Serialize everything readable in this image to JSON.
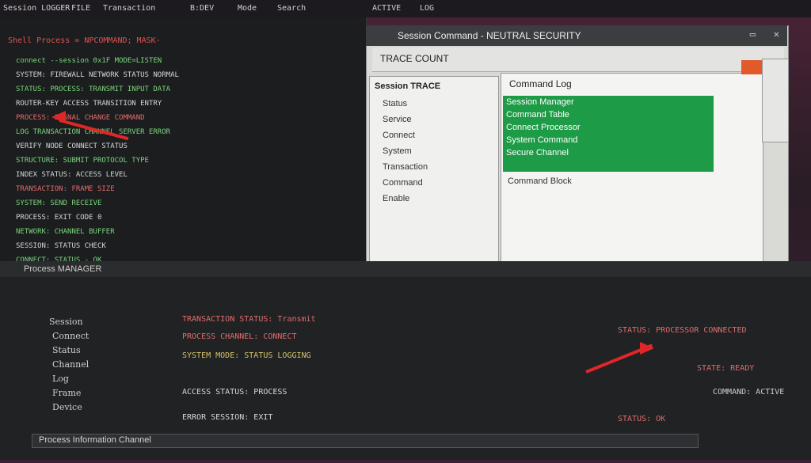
{
  "topbar": {
    "items": [
      "Session LOGGER",
      "FILE",
      "Transaction",
      "B:DEV",
      "Mode",
      "Search",
      "ACTIVE",
      "LOG"
    ]
  },
  "terminal": {
    "title": "Shell Process = NPCOMMAND; MASK-",
    "lines": [
      "  connect --session 0x1F  MODE=LISTEN",
      "  SYSTEM: FIREWALL NETWORK STATUS NORMAL",
      "  STATUS: PROCESS: TRANSMIT INPUT DATA",
      "  ROUTER-KEY ACCESS TRANSITION ENTRY",
      "  PROCESS: SIGNAL CHANGE COMMAND",
      "  LOG TRANSACTION CHANNEL SERVER ERROR",
      "  VERIFY NODE CONNECT STATUS",
      "  STRUCTURE: SUBMIT PROTOCOL TYPE",
      "  INDEX STATUS: ACCESS LEVEL",
      "  TRANSACTION: FRAME SIZE",
      "  SYSTEM: SEND RECEIVE",
      "  PROCESS: EXIT CODE 0",
      "  NETWORK: CHANNEL BUFFER",
      "  SESSION: STATUS CHECK",
      "  CONNECT: STATUS - OK"
    ]
  },
  "right_window": {
    "title": "Session Command - NEUTRAL SECURITY",
    "subtitle": "TRACE COUNT",
    "sidebar_header": "Session TRACE",
    "sidebar_items": [
      "Status",
      "Service",
      "Connect",
      "System",
      "Transaction",
      "Command",
      "Enable"
    ],
    "main_header": "Command Log",
    "list": [
      "Session Manager",
      "Command Table",
      "Connect Processor",
      "System Command",
      "Secure Channel"
    ],
    "footer": "Command Block"
  },
  "lower_panel": {
    "header": "Process  MANAGER",
    "row_labels": [
      "Session",
      "Connect",
      "Status",
      "Channel",
      "Log",
      "Frame",
      "Device"
    ],
    "rows": [
      "TRANSACTION  STATUS: Transmit",
      "PROCESS  CHANNEL: CONNECT",
      "SYSTEM  MODE: STATUS LOGGING",
      "ACCESS  STATUS: PROCESS",
      "ERROR  SESSION: EXIT"
    ],
    "right_col": [
      "STATUS: PROCESSOR CONNECTED",
      "STATE: READY",
      "COMMAND: ACTIVE",
      "STATUS: OK"
    ],
    "footer": "Process Information Channel"
  },
  "colors": {
    "accent": "#1e9b46",
    "arrow": "#e02727"
  }
}
